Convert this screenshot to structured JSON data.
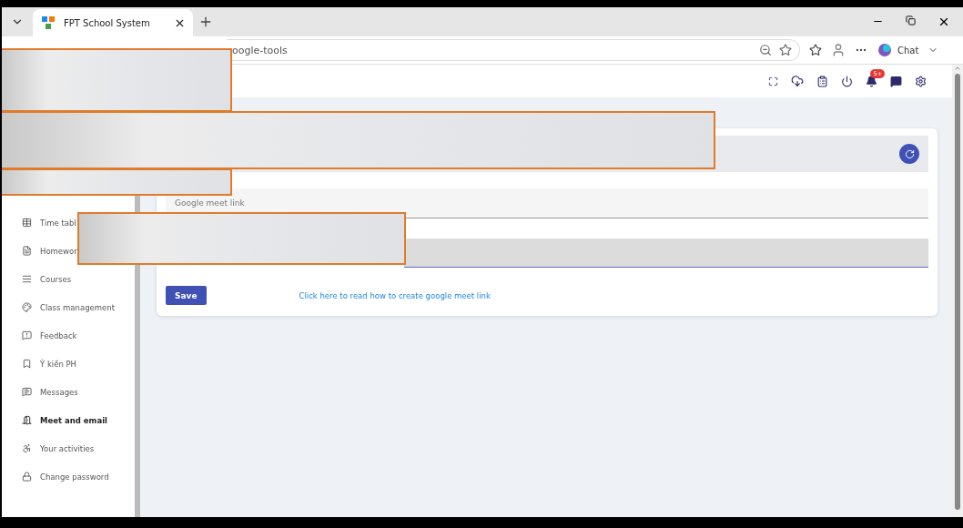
{
  "browser": {
    "tab_title": "FPT School System",
    "url": "oogle-tools",
    "chat_label": "Chat"
  },
  "header": {
    "notification_badge": "5+"
  },
  "sidebar": {
    "items": [
      {
        "kind": "table",
        "label": "Time tabl",
        "selected": false
      },
      {
        "kind": "doc",
        "label": "Homewor",
        "selected": false
      },
      {
        "kind": "lines",
        "label": "Courses",
        "selected": false
      },
      {
        "kind": "palette",
        "label": "Class management",
        "selected": false
      },
      {
        "kind": "feedback",
        "label": "Feedback",
        "selected": false
      },
      {
        "kind": "bookmark",
        "label": "Ý kiến PH",
        "selected": false
      },
      {
        "kind": "message",
        "label": "Messages",
        "selected": false
      },
      {
        "kind": "door",
        "label": "Meet and email",
        "selected": true
      },
      {
        "kind": "person",
        "label": "Your activities",
        "selected": false
      },
      {
        "kind": "lock",
        "label": "Change password",
        "selected": false
      }
    ]
  },
  "form": {
    "meet_field": {
      "placeholder": "Google meet link"
    },
    "save_label": "Save",
    "help_link": "Click here to read how to create google meet link"
  },
  "redactions": [
    {
      "kind": "blur"
    },
    {
      "kind": "blur"
    },
    {
      "kind": "blur"
    },
    {
      "kind": "blur"
    }
  ]
}
